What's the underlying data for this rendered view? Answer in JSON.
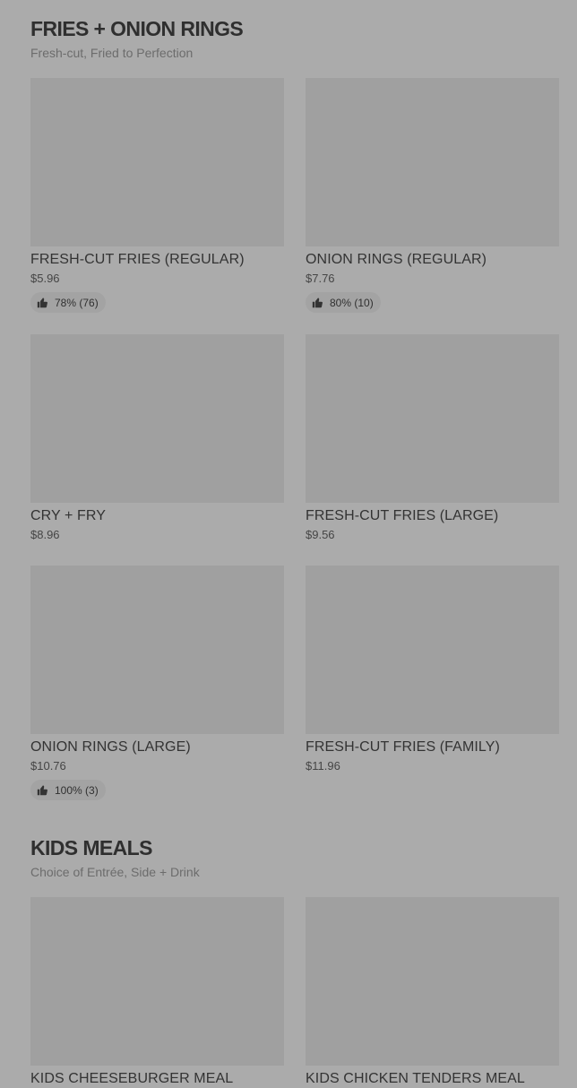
{
  "sections": [
    {
      "title": "FRIES + ONION RINGS",
      "subtitle": "Fresh-cut, Fried to Perfection",
      "items": [
        {
          "name": "FRESH-CUT FRIES (REGULAR)",
          "price": "$5.96",
          "rating": "78% (76)"
        },
        {
          "name": "ONION RINGS (REGULAR)",
          "price": "$7.76",
          "rating": "80% (10)"
        },
        {
          "name": "CRY + FRY",
          "price": "$8.96"
        },
        {
          "name": "FRESH-CUT FRIES (LARGE)",
          "price": "$9.56"
        },
        {
          "name": "ONION RINGS (LARGE)",
          "price": "$10.76",
          "rating": "100% (3)"
        },
        {
          "name": "FRESH-CUT FRIES (FAMILY)",
          "price": "$11.96"
        }
      ]
    },
    {
      "title": "KIDS MEALS",
      "subtitle": "Choice of Entrée, Side + Drink",
      "items": [
        {
          "name": "KIDS CHEESEBURGER MEAL"
        },
        {
          "name": "KIDS CHICKEN TENDERS MEAL"
        }
      ]
    }
  ],
  "icons": {
    "rating": "thumbs-up-icon"
  }
}
